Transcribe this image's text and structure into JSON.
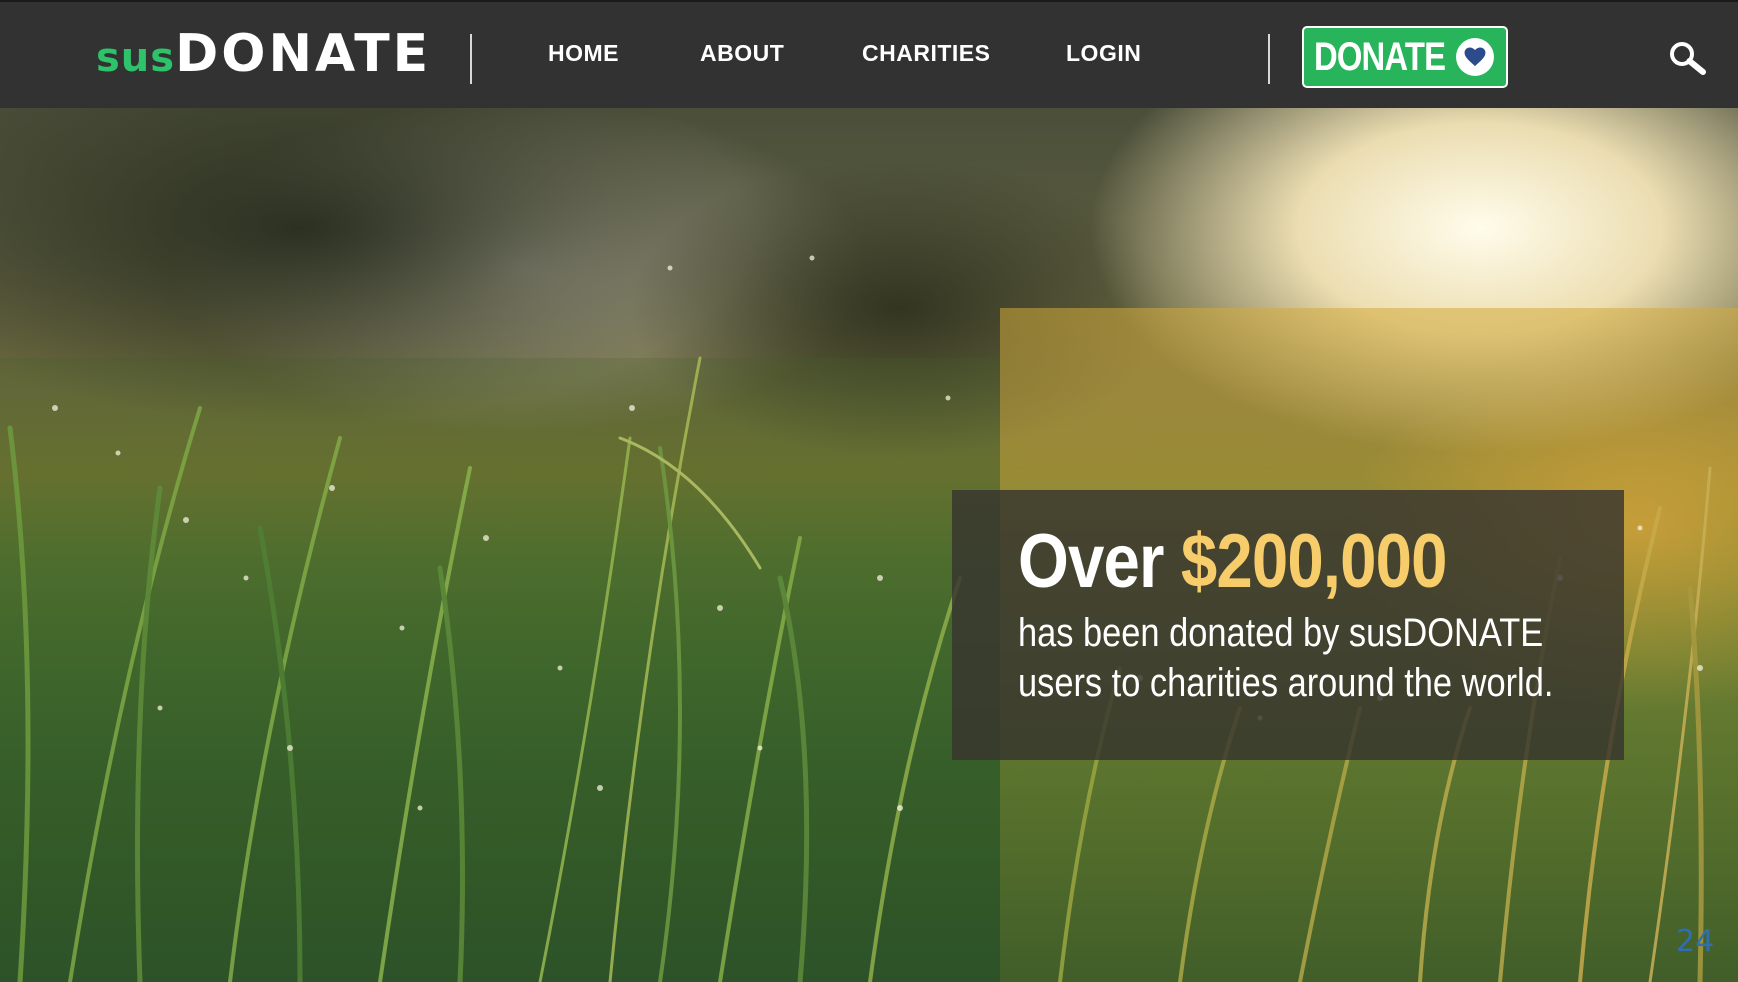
{
  "brand": {
    "logo_prefix": "sus",
    "logo_main": "DONATE",
    "accent_color": "#2ec36b",
    "highlight_color": "#f7cc6a"
  },
  "nav": {
    "items": [
      {
        "label": "HOME"
      },
      {
        "label": "ABOUT"
      },
      {
        "label": "CHARITIES"
      },
      {
        "label": "LOGIN"
      }
    ],
    "donate_button_label": "DONATE",
    "donate_button_icon": "heart-icon",
    "search_icon": "search-icon"
  },
  "hero": {
    "background": "dewy grass at sunset",
    "headline_prefix": "Over",
    "headline_amount": "$200,000",
    "body_line1": "has been donated by susDONATE",
    "body_line2": "users to charities around the world."
  },
  "slide_number": "24"
}
